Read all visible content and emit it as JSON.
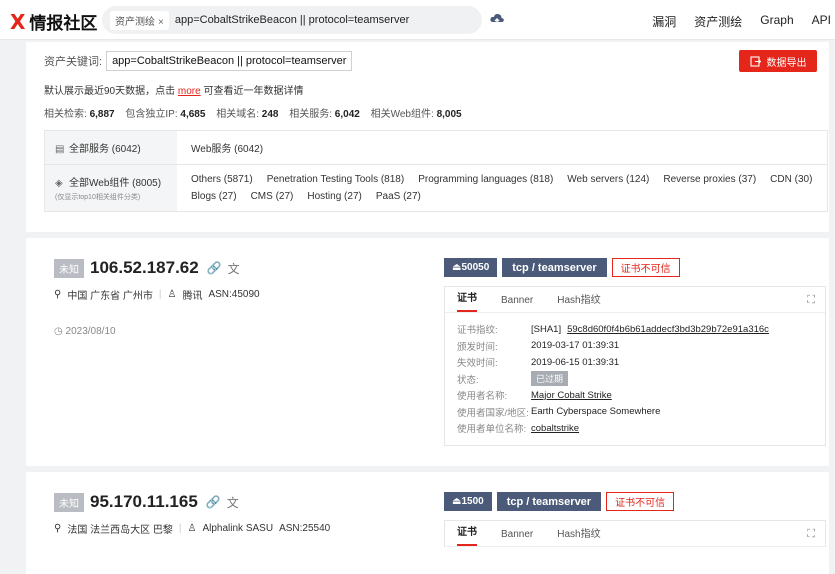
{
  "brand": {
    "mark": "X",
    "name": "情报社区"
  },
  "search": {
    "tag": "资产测绘",
    "tag_close": "×",
    "query": "app=CobaltStrikeBeacon || protocol=teamserver"
  },
  "nav": [
    "漏洞",
    "资产测绘",
    "Graph",
    "API"
  ],
  "summary": {
    "kw_label": "资产关键词:",
    "kw_value": "app=CobaltStrikeBeacon || protocol=teamserver",
    "export_label": "数据导出",
    "hint_prefix": "默认展示最近90天数据，点击",
    "hint_more": "more",
    "hint_suffix": "可查看近一年数据详情",
    "stats": [
      {
        "label": "相关检索:",
        "value": "6,887"
      },
      {
        "label": "包含独立IP:",
        "value": "4,685"
      },
      {
        "label": "相关域名:",
        "value": "248"
      },
      {
        "label": "相关服务:",
        "value": "6,042"
      },
      {
        "label": "相关Web组件:",
        "value": "8,005"
      }
    ],
    "categories": {
      "services_head": "全部服务 (6042)",
      "services": [
        "Web服务 (6042)"
      ],
      "web_head": "全部Web组件 (8005)",
      "web_sub": "(仅显示top10相关组件分类)",
      "web": [
        "Others (5871)",
        "Penetration Testing Tools (818)",
        "Programming languages (818)",
        "Web servers (124)",
        "Reverse proxies (37)",
        "CDN (30)",
        "Blogs (27)",
        "CMS (27)",
        "Hosting (27)",
        "PaaS (27)"
      ]
    }
  },
  "results": [
    {
      "badge": "未知",
      "ip": "106.52.187.62",
      "location": "中国 广东省 广州市",
      "org": "腾讯",
      "asn": "ASN:45090",
      "date": "2023/08/10",
      "port": "50050",
      "protocol": "tcp / teamserver",
      "trust": "证书不可信",
      "tabs": [
        "证书",
        "Banner",
        "Hash指纹"
      ],
      "cert": [
        {
          "label": "证书指纹:",
          "prefix": "[SHA1]",
          "value": "59c8d60f0f4b6b61addecf3bd3b29b72e91a316c",
          "link": true
        },
        {
          "label": "颁发时间:",
          "value": "2019-03-17 01:39:31"
        },
        {
          "label": "失效时间:",
          "value": "2019-06-15 01:39:31"
        },
        {
          "label": "状态:",
          "value": "已过期",
          "badge": true
        },
        {
          "label": "使用者名称:",
          "value": "Major Cobalt Strike",
          "link": true
        },
        {
          "label": "使用者国家/地区:",
          "value": "Earth Cyberspace Somewhere"
        },
        {
          "label": "使用者单位名称:",
          "value": "cobaltstrike",
          "link": true
        }
      ]
    },
    {
      "badge": "未知",
      "ip": "95.170.11.165",
      "location": "法国 法兰西岛大区 巴黎",
      "org": "Alphalink SASU",
      "asn": "ASN:25540",
      "port": "1500",
      "protocol": "tcp / teamserver",
      "trust": "证书不可信",
      "tabs": [
        "证书",
        "Banner",
        "Hash指纹"
      ]
    }
  ],
  "icons": {
    "cloud": "cloud-upload-icon",
    "export": "export-icon",
    "pin": "location-pin-icon",
    "org": "org-icon",
    "clock": "clock-icon",
    "link": "link-icon",
    "expand": "expand-icon"
  },
  "colors": {
    "accent": "#e5251a",
    "tag": "#4a5a78"
  }
}
